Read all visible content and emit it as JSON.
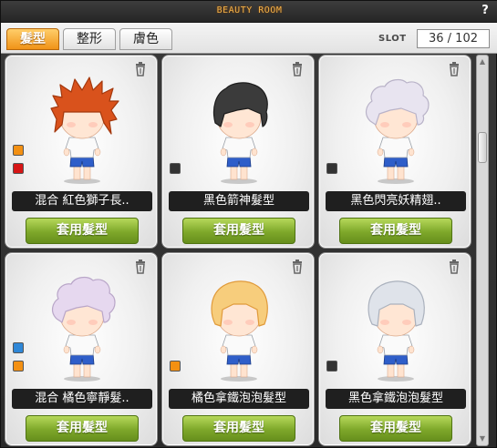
{
  "window": {
    "title": "BEAUTY ROOM",
    "help_label": "?"
  },
  "tabs": [
    {
      "label": "髮型",
      "active": true
    },
    {
      "label": "整形",
      "active": false
    },
    {
      "label": "膚色",
      "active": false
    }
  ],
  "slot": {
    "label": "SLOT",
    "value": "36 / 102"
  },
  "cards": [
    {
      "name": "混合  紅色獅子長..",
      "button": "套用髮型",
      "hair": "spiky",
      "hair_color": "#d9521c",
      "hair_shade": "#a3380d",
      "swatches": [
        "#f39012",
        "#d61515"
      ]
    },
    {
      "name": "黑色箭神髮型",
      "button": "套用髮型",
      "hair": "wavy",
      "hair_color": "#3b3b3b",
      "hair_shade": "#1c1c1c",
      "swatches": [
        "#333333"
      ]
    },
    {
      "name": "黑色閃亮妖精翅..",
      "button": "套用髮型",
      "hair": "fluffy",
      "hair_color": "#e8e4f0",
      "hair_shade": "#b9b3c8",
      "swatches": [
        "#333333"
      ]
    },
    {
      "name": "混合  橘色寧靜髮..",
      "button": "套用髮型",
      "hair": "fluffy",
      "hair_color": "#e6d8ef",
      "hair_shade": "#b9a6c8",
      "swatches": [
        "#2f87d7",
        "#f39012"
      ]
    },
    {
      "name": "橘色拿鐵泡泡髮型",
      "button": "套用髮型",
      "hair": "bob",
      "hair_color": "#f7cd7c",
      "hair_shade": "#e09a3a",
      "swatches": [
        "#f39012"
      ]
    },
    {
      "name": "黑色拿鐵泡泡髮型",
      "button": "套用髮型",
      "hair": "bob",
      "hair_color": "#dfe3ea",
      "hair_shade": "#aab1bd",
      "swatches": [
        "#333333"
      ]
    }
  ]
}
